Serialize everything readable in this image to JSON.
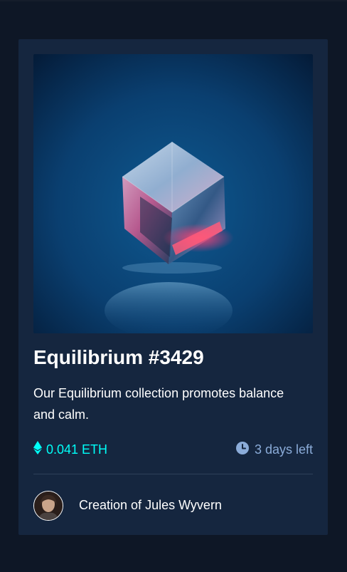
{
  "card": {
    "title": "Equilibrium #3429",
    "description": "Our Equilibrium collection promotes balance and calm.",
    "price": "0.041 ETH",
    "time_left": "3 days left",
    "creator_prefix": "Creation of",
    "creator_name": "Jules Wyvern"
  },
  "icons": {
    "price": "ethereum-icon",
    "time": "clock-icon"
  },
  "colors": {
    "background": "#0e1726",
    "card": "#15263f",
    "accent_cyan": "#00fff8",
    "muted_blue": "#8bacd9",
    "divider": "#2e405a"
  }
}
